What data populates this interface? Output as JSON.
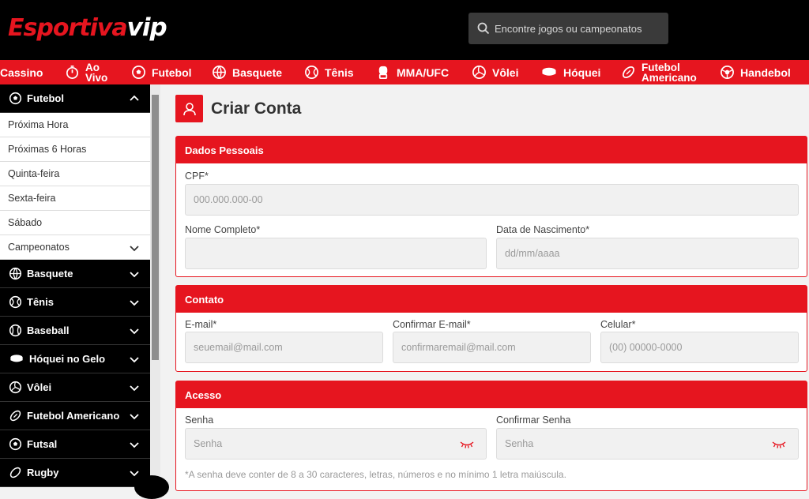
{
  "header": {
    "logo_part1": "Esportiva",
    "logo_part2": "vip",
    "search_placeholder": "Encontre jogos ou campeonatos"
  },
  "sports_nav": [
    {
      "label": "Cassino",
      "icon": "none"
    },
    {
      "label": "Ao Vivo",
      "icon": "stopwatch-icon"
    },
    {
      "label": "Futebol",
      "icon": "soccer-ball-icon"
    },
    {
      "label": "Basquete",
      "icon": "basketball-icon"
    },
    {
      "label": "Tênis",
      "icon": "tennis-ball-icon"
    },
    {
      "label": "MMA/UFC",
      "icon": "boxing-glove-icon"
    },
    {
      "label": "Vôlei",
      "icon": "volleyball-icon"
    },
    {
      "label": "Hóquei",
      "icon": "hockey-puck-icon"
    },
    {
      "label": "Futebol Americano",
      "icon": "american-football-icon"
    },
    {
      "label": "Handebol",
      "icon": "handball-icon"
    }
  ],
  "sidebar": {
    "futebol_label": "Futebol",
    "sub_items": [
      "Próxima Hora",
      "Próximas 6 Horas",
      "Quinta-feira",
      "Sexta-feira",
      "Sábado",
      "Campeonatos"
    ],
    "sports": [
      "Basquete",
      "Tênis",
      "Baseball",
      "Hóquei no Gelo",
      "Vôlei",
      "Futebol Americano",
      "Futsal",
      "Rugby"
    ]
  },
  "main": {
    "title": "Criar Conta",
    "dados_pessoais": {
      "title": "Dados Pessoais",
      "cpf_label": "CPF*",
      "cpf_placeholder": "000.000.000-00",
      "nome_label": "Nome Completo*",
      "nome_placeholder": "",
      "nascimento_label": "Data de Nascimento*",
      "nascimento_placeholder": "dd/mm/aaaa"
    },
    "contato": {
      "title": "Contato",
      "email_label": "E-mail*",
      "email_placeholder": "seuemail@mail.com",
      "confirm_email_label": "Confirmar E-mail*",
      "confirm_email_placeholder": "confirmaremail@mail.com",
      "celular_label": "Celular*",
      "celular_placeholder": "(00) 00000-0000"
    },
    "acesso": {
      "title": "Acesso",
      "senha_label": "Senha",
      "senha_placeholder": "Senha",
      "confirm_senha_label": "Confirmar Senha",
      "confirm_senha_placeholder": "Senha",
      "hint": "*A senha deve conter de 8 a 30 caracteres, letras, números e no mínimo 1 letra maiúscula."
    }
  },
  "colors": {
    "brand_red": "#e6151f",
    "header_black": "#000000"
  }
}
